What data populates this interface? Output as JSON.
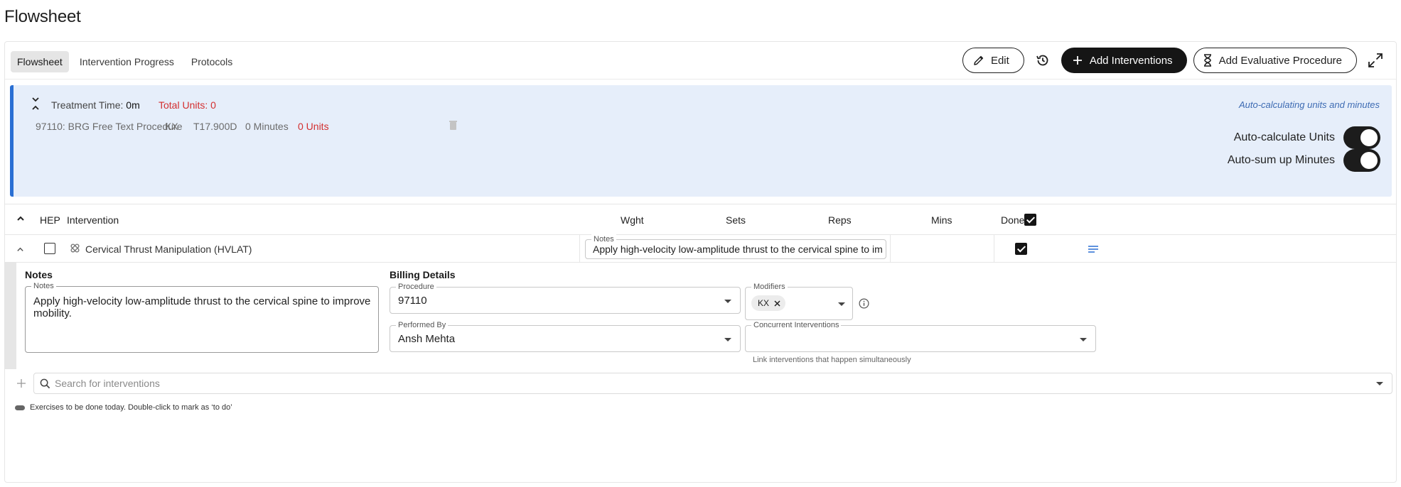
{
  "page": {
    "title": "Flowsheet"
  },
  "tabs": [
    "Flowsheet",
    "Intervention Progress",
    "Protocols"
  ],
  "toolbar": {
    "edit_label": "Edit",
    "add_interventions_label": "Add Interventions",
    "add_evaluative_label": "Add Evaluative Procedure"
  },
  "banner": {
    "treatment_time_label": "Treatment Time: ",
    "treatment_time_value": "0m",
    "total_units": "Total Units: 0",
    "procedure": {
      "code_name": "97110: BRG Free Text Procedure",
      "modifier": "KX",
      "diagnosis": "T17.900D",
      "minutes": "0 Minutes",
      "units": "0 Units"
    },
    "auto_note": "Auto-calculating units and minutes",
    "auto_units_label": "Auto-calculate Units",
    "auto_units_on": true,
    "auto_minutes_label": "Auto-sum up Minutes",
    "auto_minutes_on": true
  },
  "table": {
    "headers": {
      "hep": "HEP",
      "intervention": "Intervention",
      "wght": "Wght",
      "sets": "Sets",
      "reps": "Reps",
      "mins": "Mins",
      "done": "Done"
    },
    "header_done_checked": true,
    "rows": [
      {
        "name": "Cervical Thrust Manipulation (HVLAT)",
        "hep_checked": false,
        "notes_label": "Notes",
        "notes": "Apply high-velocity low-amplitude thrust to the cervical spine to improve mobility.",
        "wght": "",
        "sets": "",
        "reps": "",
        "mins": "",
        "done_checked": true
      }
    ]
  },
  "expanded": {
    "notes_title": "Notes",
    "notes_label": "Notes",
    "notes_value": "Apply high-velocity low-amplitude thrust to the cervical spine to improve mobility.",
    "billing_title": "Billing Details",
    "procedure_label": "Procedure",
    "procedure_value": "97110",
    "modifiers_label": "Modifiers",
    "modifier_chip": "KX",
    "performed_by_label": "Performed By",
    "performed_by_value": "Ansh Mehta",
    "concurrent_label": "Concurrent Interventions",
    "concurrent_helper": "Link interventions that happen simultaneously"
  },
  "search": {
    "placeholder": "Search for interventions"
  },
  "legend_note": "Exercises to be done today. Double-click to mark as ‘to do’",
  "colors": {
    "accent_blue": "#2a6fd3",
    "banner_bg": "#e6eefa",
    "units_red": "#d32f2f",
    "dark_button": "#151515"
  }
}
